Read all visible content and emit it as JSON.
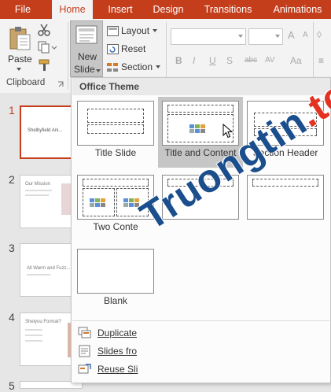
{
  "tabs": [
    {
      "label": "File",
      "active": false
    },
    {
      "label": "Home",
      "active": true
    },
    {
      "label": "Insert",
      "active": false
    },
    {
      "label": "Design",
      "active": false
    },
    {
      "label": "Transitions",
      "active": false
    },
    {
      "label": "Animations",
      "active": false
    }
  ],
  "ribbon": {
    "paste_label": "Paste",
    "clipboard_group_label": "Clipboard",
    "new_slide_label_1": "New",
    "new_slide_label_2": "Slide",
    "layout_label": "Layout",
    "reset_label": "Reset",
    "section_label": "Section",
    "bold": "B",
    "italic": "I",
    "underline": "U",
    "shadow": "S",
    "strikethrough": "abc",
    "spacing": "AV",
    "case": "Aa",
    "grow": "A",
    "shrink": "A"
  },
  "slides": [
    {
      "number": "1",
      "title": "Shelbyfield Ani..."
    },
    {
      "number": "2",
      "title": "Our Mission"
    },
    {
      "number": "3",
      "title": "All Warm and Fuzz..."
    },
    {
      "number": "4",
      "title": "Shelyou Format?"
    },
    {
      "number": "5",
      "title": ""
    }
  ],
  "dropdown": {
    "header": "Office Theme",
    "layouts": [
      {
        "label": "Title Slide",
        "selected": false
      },
      {
        "label": "Title and Content",
        "selected": true
      },
      {
        "label": "Section Header",
        "selected": false
      },
      {
        "label": "Two Conte",
        "selected": false
      },
      {
        "label": "",
        "selected": false
      },
      {
        "label": "",
        "selected": false
      },
      {
        "label": "Blank",
        "selected": false
      }
    ],
    "menu": [
      {
        "label": "Duplicate"
      },
      {
        "label": "Slides fro"
      },
      {
        "label": "Reuse Sli"
      }
    ]
  },
  "watermark": {
    "main": "Truongtin",
    "dot": ".",
    "tld": "top"
  },
  "colors": {
    "accent": "#c43e1c",
    "watermark_blue": "#1b4e8c",
    "watermark_red": "#e3321f"
  }
}
